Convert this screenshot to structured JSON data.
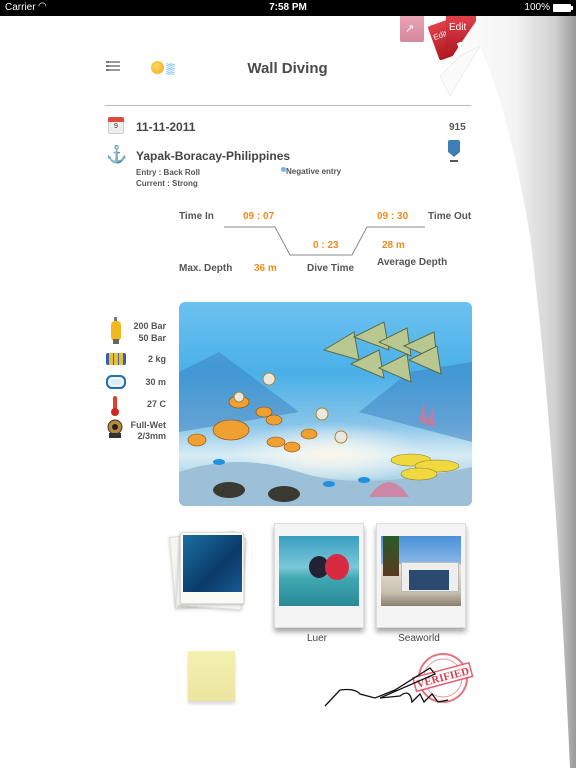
{
  "status_bar": {
    "carrier": "Carrier",
    "time": "7:58 PM",
    "battery": "100%"
  },
  "header": {
    "title": "Wall Diving",
    "share_label": "",
    "edit_label_small": "Edit",
    "edit_label": "Edit"
  },
  "dive": {
    "date": "11-11-2011",
    "calendar_day": "9",
    "log_number": "915",
    "location": "Yapak-Boracay-Philippines",
    "entry": "Entry : Back Roll",
    "current": "Current : Strong",
    "negative_entry": "Negative entry"
  },
  "profile": {
    "time_in_label": "Time In",
    "time_in": "09 : 07",
    "time_out_label": "Time Out",
    "time_out": "09 : 30",
    "dive_time": "0 : 23",
    "dive_time_label": "Dive Time",
    "avg_depth": "28 m",
    "avg_depth_label": "Average Depth",
    "max_depth_label": "Max. Depth",
    "max_depth": "36 m"
  },
  "equipment": {
    "tank_start": "200 Bar",
    "tank_end": "50 Bar",
    "weight": "2 kg",
    "visibility": "30 m",
    "temperature": "27 C",
    "suit_type": "Full-Wet",
    "suit_thickness": "2/3mm"
  },
  "photos": [
    {
      "caption": ""
    },
    {
      "caption": "Luer"
    },
    {
      "caption": "Seaworld"
    }
  ],
  "signature": {
    "stamp": "VERIFIED"
  },
  "colors": {
    "accent_orange": "#f08a1e",
    "edit_red": "#c8282e",
    "share_pink": "#e0a0b0"
  }
}
